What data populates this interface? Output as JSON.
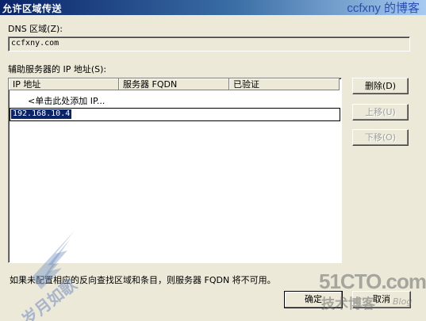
{
  "window": {
    "title": "允许区域传送",
    "watermark_top": "ccfxny 的博客"
  },
  "dns_zone": {
    "label": "DNS 区域(Z):",
    "value": "ccfxny.com"
  },
  "secondary_servers": {
    "label": "辅助服务器的 IP 地址(S):",
    "columns": [
      "IP 地址",
      "服务器 FQDN",
      "已验证"
    ],
    "add_row_text": "<单击此处添加 IP...",
    "editing_value": "192.168.10.4"
  },
  "buttons": {
    "delete": "删除(D)",
    "move_up": "上移(U)",
    "move_down": "下移(O)",
    "ok": "确定",
    "cancel": "取消"
  },
  "note": "如果未配置相应的反向查找区域和条目，则服务器 FQDN 将不可用。",
  "watermarks": {
    "site_51cto": "51CTO.com",
    "tech_blog": "技术博客",
    "blog": "Blog",
    "left_logo": "岁月如歌"
  }
}
